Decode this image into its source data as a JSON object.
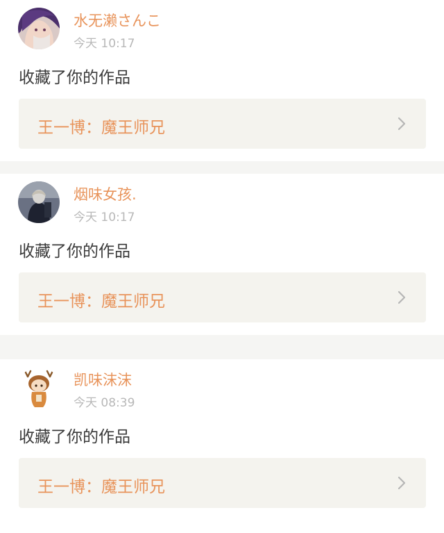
{
  "notifications": [
    {
      "username": "水无濑さんこ",
      "time": "今天 10:17",
      "action": "收藏了你的作品",
      "work_title": "王一博：魔王师兄",
      "avatar_icon": "anime-girl-purple-hair-avatar"
    },
    {
      "username": "烟味女孩.",
      "time": "今天 10:17",
      "action": "收藏了你的作品",
      "work_title": "王一博：魔王师兄",
      "avatar_icon": "dark-photo-person-avatar"
    },
    {
      "username": "凯味沫沫",
      "time": "今天 08:39",
      "action": "收藏了你的作品",
      "work_title": "王一博：魔王师兄",
      "avatar_icon": "chibi-antler-character-avatar"
    }
  ],
  "colors": {
    "accent": "#e8935a",
    "text": "#3a3a3a",
    "muted": "#b8b8b8",
    "link_bg": "#f4f3ee",
    "page_bg": "#f5f5f3"
  }
}
